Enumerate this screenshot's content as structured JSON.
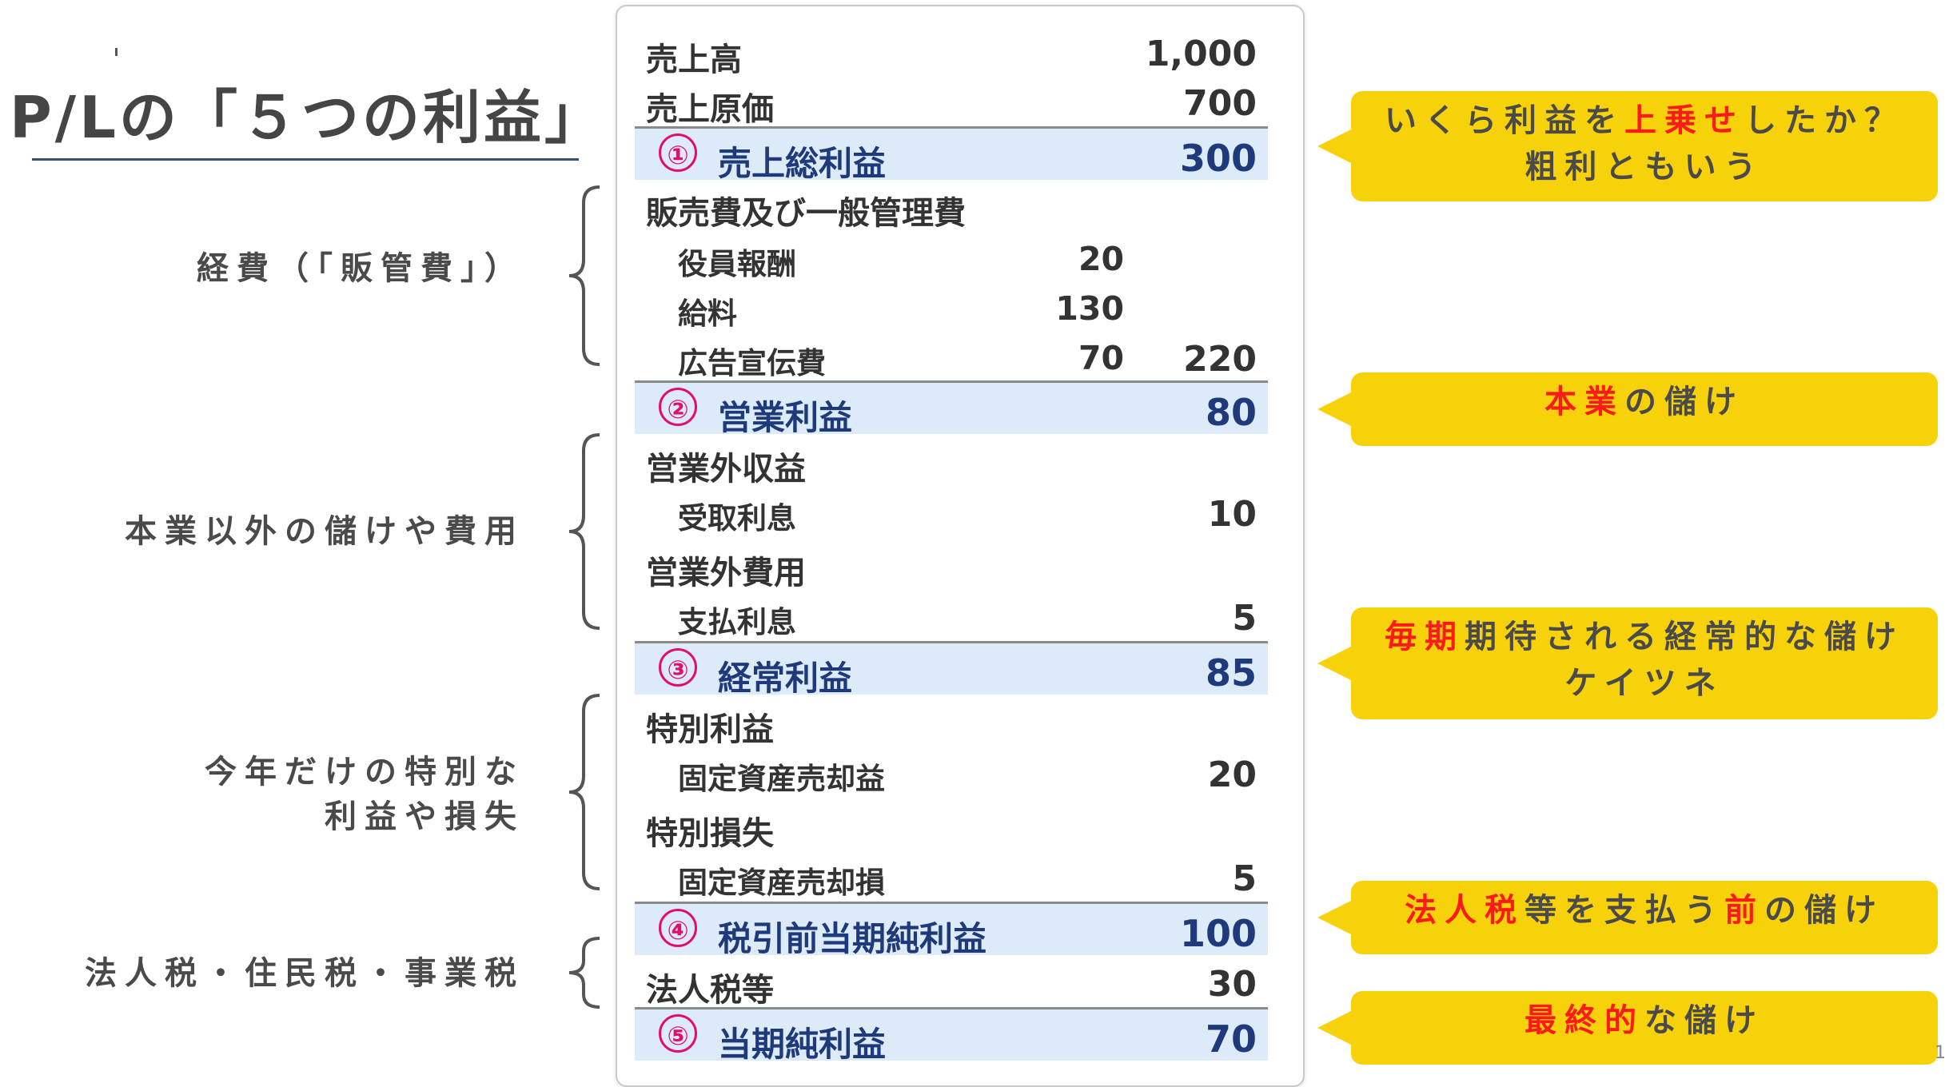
{
  "title": "P/Lの「５つの利益」",
  "groups": [
    {
      "lines": [
        "経費（「販管費」）"
      ]
    },
    {
      "lines": [
        "本業以外の儲けや費用"
      ]
    },
    {
      "lines": [
        "今年だけの特別な",
        "利益や損失"
      ]
    },
    {
      "lines": [
        "法人税・住民税・事業税"
      ]
    }
  ],
  "pl": {
    "sales": {
      "label": "売上高",
      "value": "1,000"
    },
    "cogs": {
      "label": "売上原価",
      "value": "700"
    },
    "p1": {
      "num": "①",
      "label": "売上総利益",
      "value": "300"
    },
    "sga": {
      "label": "販売費及び一般管理費"
    },
    "officer": {
      "label": "役員報酬",
      "value": "20"
    },
    "salary": {
      "label": "給料",
      "value": "130"
    },
    "ads": {
      "label": "広告宣伝費",
      "value": "70",
      "total": "220"
    },
    "p2": {
      "num": "②",
      "label": "営業利益",
      "value": "80"
    },
    "nonop_income": {
      "label": "営業外収益"
    },
    "interest_recv": {
      "label": "受取利息",
      "value": "10"
    },
    "nonop_exp": {
      "label": "営業外費用"
    },
    "interest_paid": {
      "label": "支払利息",
      "value": "5"
    },
    "p3": {
      "num": "③",
      "label": "経常利益",
      "value": "85"
    },
    "special_gain": {
      "label": "特別利益"
    },
    "asset_gain": {
      "label": "固定資産売却益",
      "value": "20"
    },
    "special_loss": {
      "label": "特別損失"
    },
    "asset_loss": {
      "label": "固定資産売却損",
      "value": "5"
    },
    "p4": {
      "num": "④",
      "label": "税引前当期純利益",
      "value": "100"
    },
    "tax": {
      "label": "法人税等",
      "value": "30"
    },
    "p5": {
      "num": "⑤",
      "label": "当期純利益",
      "value": "70"
    }
  },
  "callouts": {
    "c1": {
      "a": "いくら利益を",
      "b": "上乗せ",
      "c": "したか？",
      "line2": "粗利ともいう"
    },
    "c2": {
      "a": "本業",
      "b": "の儲け"
    },
    "c3": {
      "a": "毎期",
      "b": "期待される経常的な儲け",
      "line2": "ケイツネ"
    },
    "c4": {
      "a": "法人税",
      "b": "等を支払う",
      "c": "前",
      "d": "の儲け"
    },
    "c5": {
      "a": "最終的",
      "b": "な儲け"
    }
  },
  "page_number": "1",
  "colors": {
    "accent_red": "#ff1a1a",
    "callout_yellow": "#f7d20a",
    "profit_band": "#dcebf7",
    "profit_text": "#1f3a7a",
    "circle_pink": "#e0106a"
  }
}
